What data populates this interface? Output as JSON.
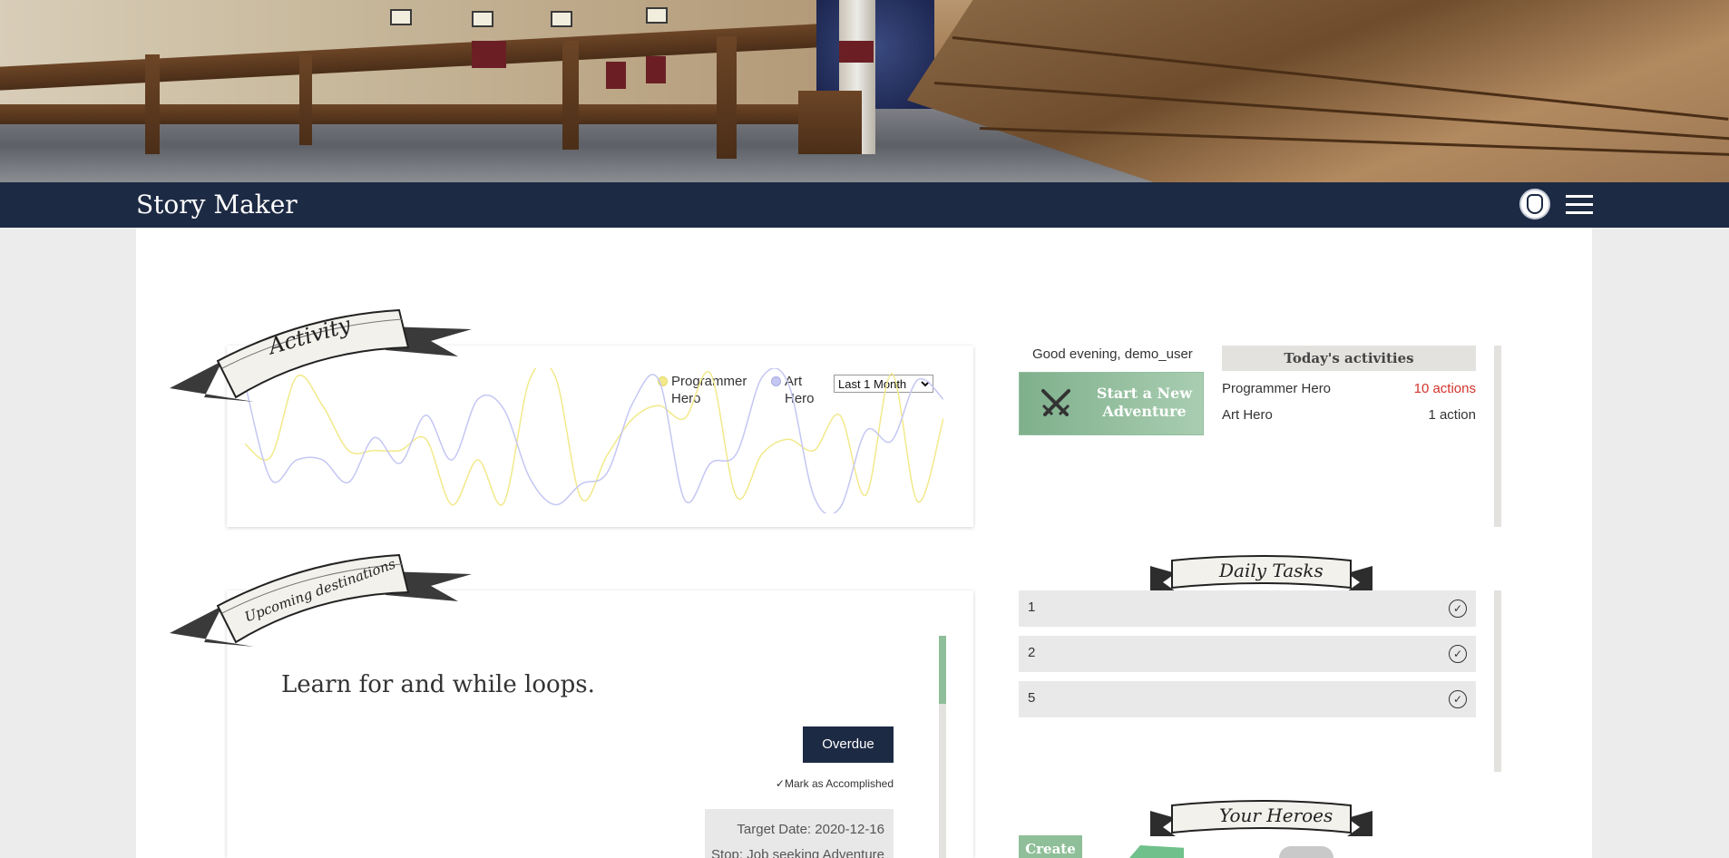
{
  "app": {
    "title": "Story Maker"
  },
  "header": {
    "emblem_icon": "shield-emblem-icon",
    "menu_icon": "hamburger-icon"
  },
  "activity": {
    "ribbon_title": "Activity",
    "legend": [
      {
        "label": "Programmer Hero",
        "color": "#f2e98a"
      },
      {
        "label": "Art Hero",
        "color": "#c4c7f2"
      }
    ],
    "range_options": [
      "Last 1 Month"
    ],
    "range_selected": "Last 1 Month"
  },
  "chart_data": {
    "type": "line",
    "title": "",
    "xlabel": "",
    "ylabel": "",
    "series": [
      {
        "name": "Programmer Hero",
        "color": "#f2e98a",
        "values": [
          40,
          32,
          82,
          64,
          36,
          36,
          36,
          43,
          2,
          30,
          3,
          80,
          82,
          6,
          33,
          56,
          64,
          56,
          84,
          7,
          34,
          43,
          36,
          58,
          8,
          84,
          4,
          56
        ]
      },
      {
        "name": "Art Hero",
        "color": "#c4c7f2",
        "values": [
          78,
          18,
          30,
          30,
          16,
          44,
          28,
          58,
          30,
          68,
          62,
          19,
          2,
          15,
          22,
          66,
          80,
          5,
          28,
          34,
          82,
          78,
          7,
          0,
          48,
          42,
          80,
          68
        ]
      }
    ]
  },
  "greeting": "Good evening, demo_user",
  "start_button": {
    "label": "Start a New Adventure",
    "icon": "crossed-swords-icon"
  },
  "today": {
    "title": "Today's activities",
    "rows": [
      {
        "name": "Programmer Hero",
        "count": "10 actions",
        "highlight": true
      },
      {
        "name": "Art Hero",
        "count": "1 action",
        "highlight": false
      }
    ]
  },
  "upcoming": {
    "ribbon_title": "Upcoming destinations",
    "goal_title": "Learn for and while loops.",
    "status_button": "Overdue",
    "mark_label": "Mark as Accomplished",
    "target_date": "Target Date: 2020-12-16",
    "stop": "Stop: Job seeking Adventure"
  },
  "daily_tasks": {
    "ribbon_title": "Daily Tasks",
    "items": [
      {
        "label": "1"
      },
      {
        "label": "2"
      },
      {
        "label": "5"
      }
    ]
  },
  "heroes": {
    "ribbon_title": "Your Heroes",
    "create_label": "Create"
  }
}
